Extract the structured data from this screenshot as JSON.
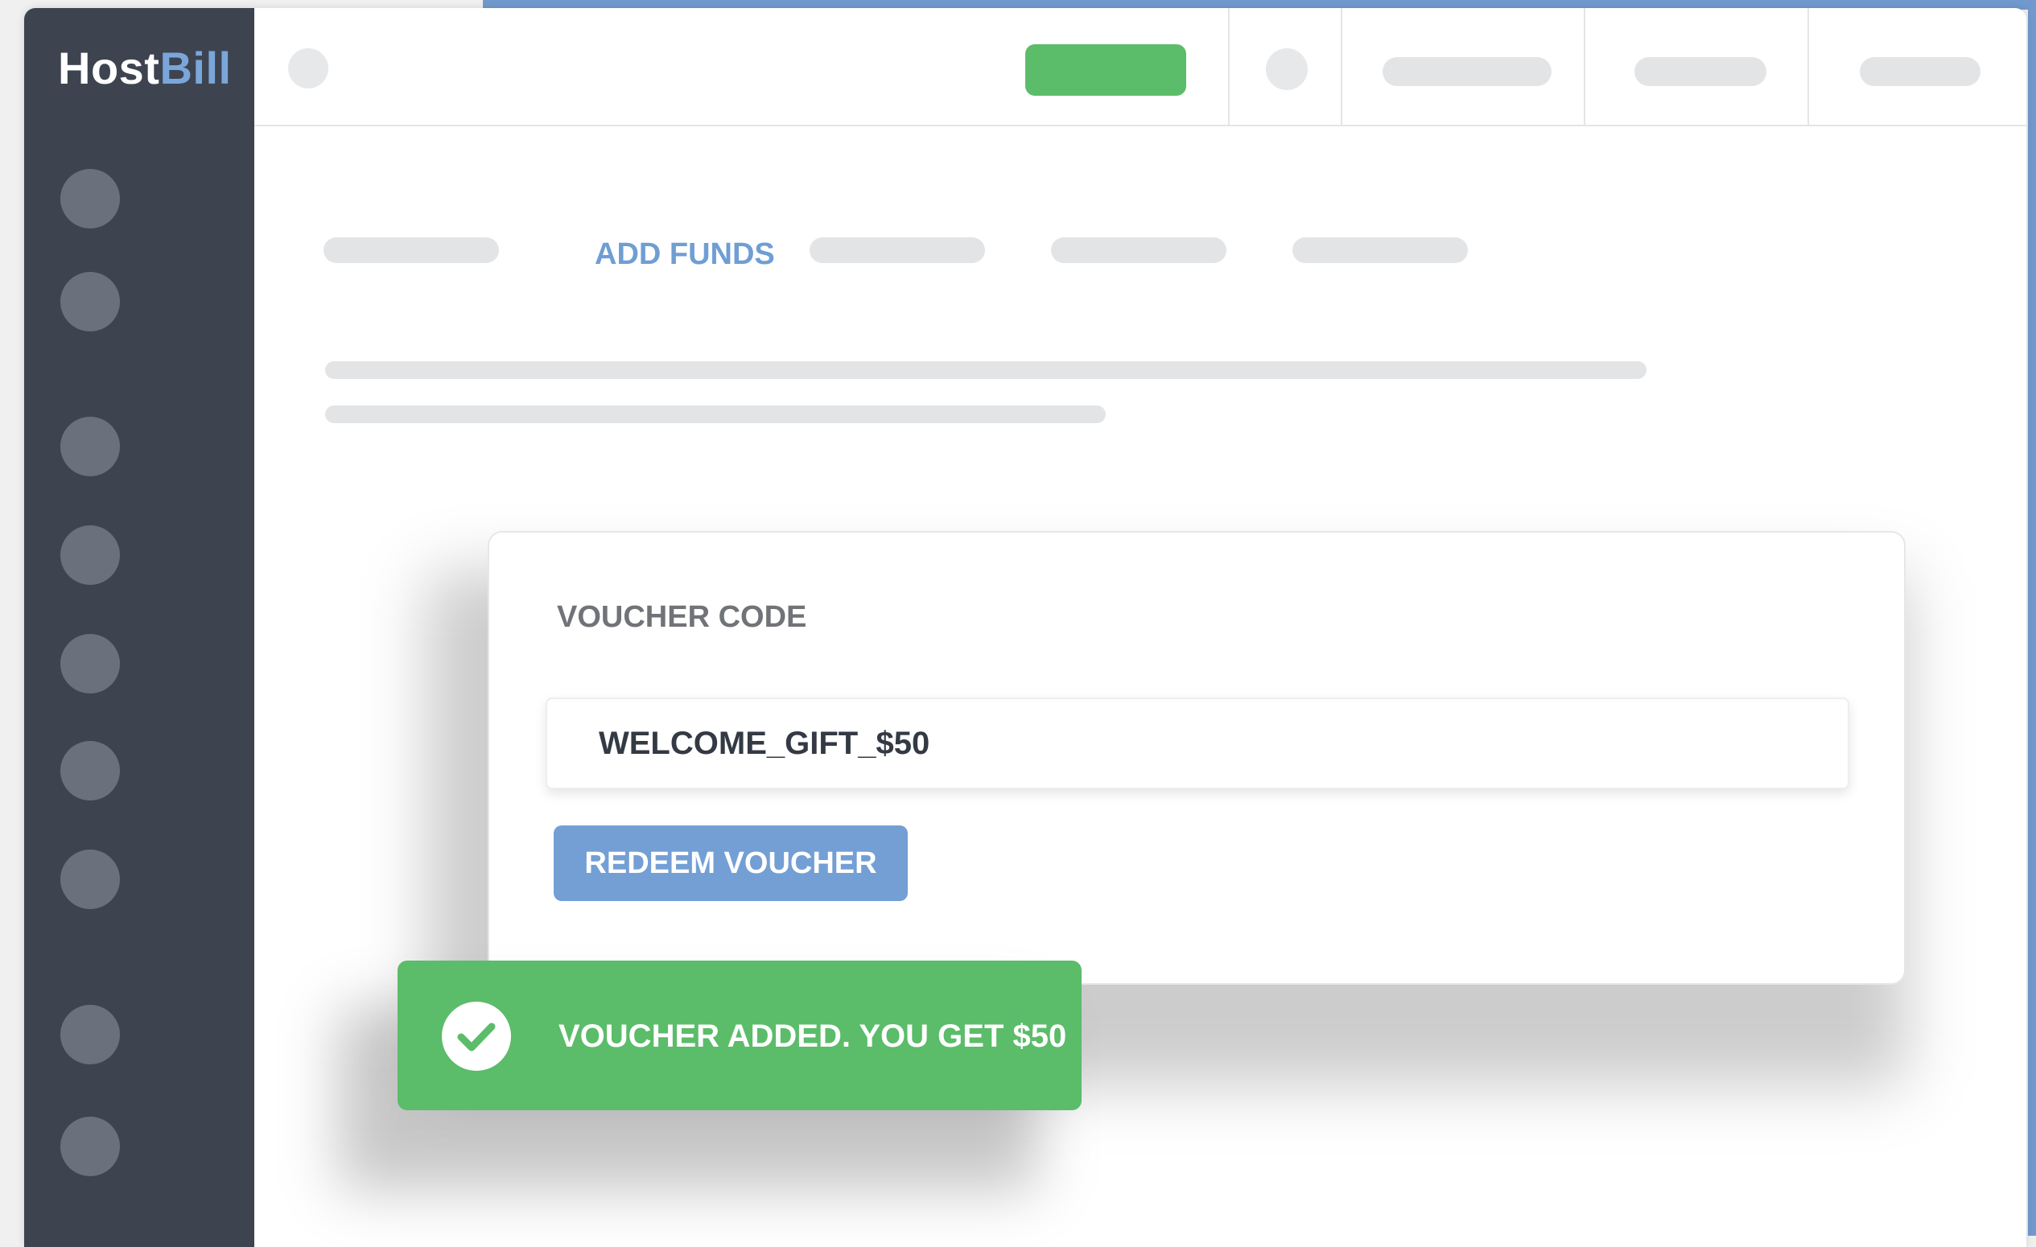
{
  "app": {
    "logo_host": "Host",
    "logo_bill": "Bill"
  },
  "tabs": {
    "active_label": "ADD FUNDS"
  },
  "voucher": {
    "label": "VOUCHER CODE",
    "value": "WELCOME_GIFT_$50",
    "redeem_label": "REDEEM VOUCHER"
  },
  "toast": {
    "message": "VOUCHER ADDED. YOU GET $50",
    "icon": "check-circle-icon"
  },
  "colors": {
    "sidebar": "#3d4450",
    "accent_blue": "#739fd5",
    "success_green": "#5bbc69"
  }
}
